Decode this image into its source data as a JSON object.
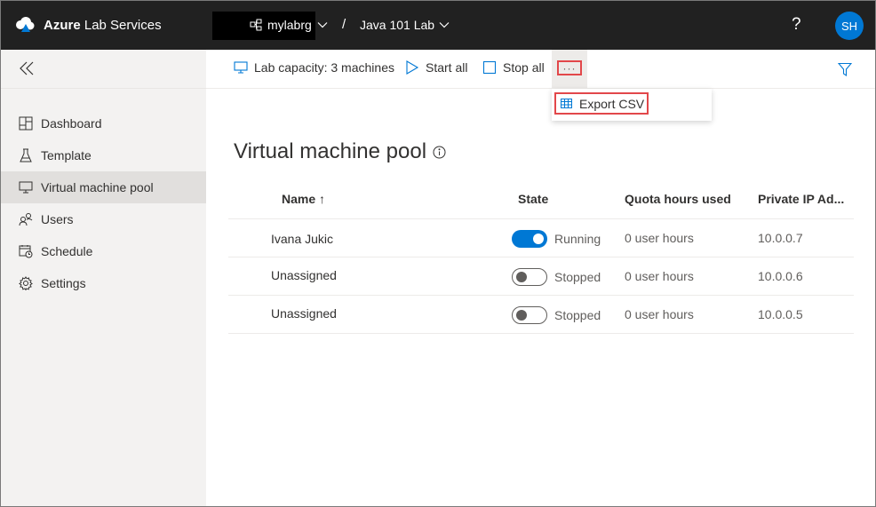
{
  "header": {
    "brand_bold": "Azure",
    "brand_rest": " Lab Services",
    "resource_group": "mylabrg",
    "breadcrumb_separator": "/",
    "lab_name": "Java 101 Lab",
    "help_label": "?",
    "avatar_initials": "SH",
    "accent_color": "#0078d4"
  },
  "sidebar": {
    "items": [
      {
        "label": "Dashboard",
        "icon": "dashboard-icon"
      },
      {
        "label": "Template",
        "icon": "flask-icon"
      },
      {
        "label": "Virtual machine pool",
        "icon": "monitor-icon",
        "active": true
      },
      {
        "label": "Users",
        "icon": "users-icon"
      },
      {
        "label": "Schedule",
        "icon": "calendar-clock-icon"
      },
      {
        "label": "Settings",
        "icon": "gear-icon"
      }
    ]
  },
  "commandbar": {
    "lab_capacity": "Lab capacity: 3 machines",
    "start_all": "Start all",
    "stop_all": "Stop all",
    "more": "···"
  },
  "menu": {
    "export_csv": "Export CSV"
  },
  "main": {
    "title": "Virtual machine pool",
    "columns": {
      "name": "Name ↑",
      "state": "State",
      "quota": "Quota hours used",
      "ip": "Private IP Ad..."
    },
    "rows": [
      {
        "name": "Ivana Jukic",
        "running": true,
        "state": "Running",
        "quota": "0 user hours",
        "ip": "10.0.0.7"
      },
      {
        "name": "Unassigned",
        "running": false,
        "state": "Stopped",
        "quota": "0 user hours",
        "ip": "10.0.0.6"
      },
      {
        "name": "Unassigned",
        "running": false,
        "state": "Stopped",
        "quota": "0 user hours",
        "ip": "10.0.0.5"
      }
    ]
  }
}
